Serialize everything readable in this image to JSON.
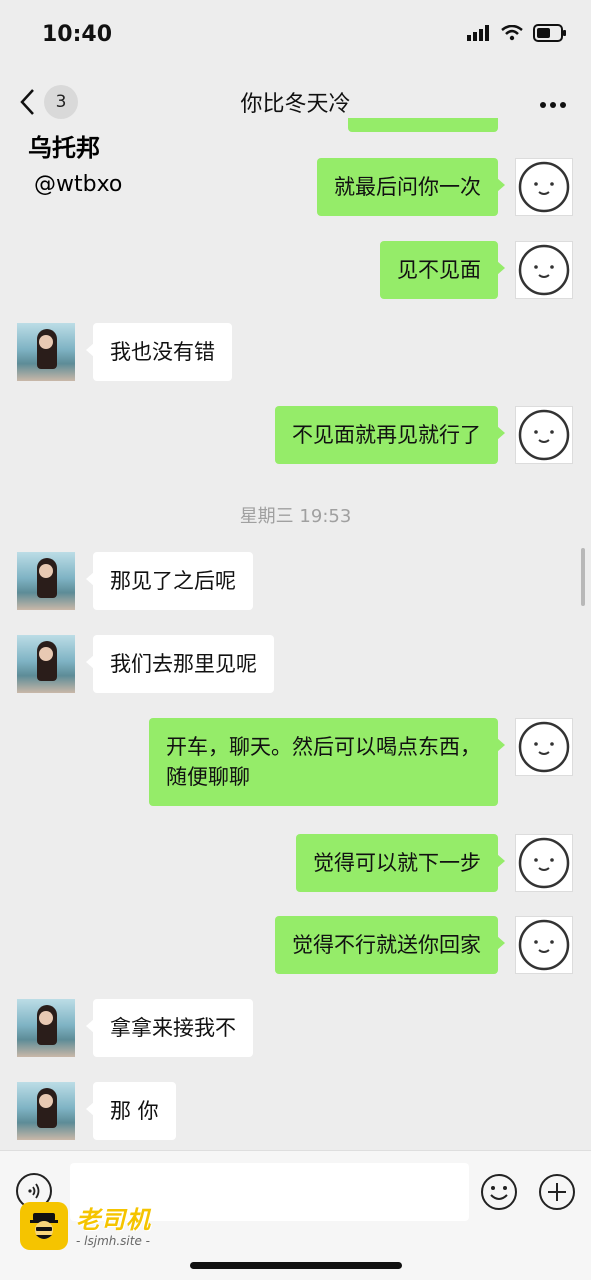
{
  "status_bar": {
    "time": "10:40"
  },
  "nav": {
    "unread_count": "3",
    "title": "你比冬天冷"
  },
  "overlay": {
    "name": "乌托邦",
    "handle": "@wtbxo"
  },
  "messages": [
    {
      "side": "right",
      "text": "就最后问你一次"
    },
    {
      "side": "right",
      "text": "见不见面"
    },
    {
      "side": "left",
      "text": "我也没有错"
    },
    {
      "side": "right",
      "text": "不见面就再见就行了"
    },
    {
      "side": "left",
      "text": "那见了之后呢"
    },
    {
      "side": "left",
      "text": "我们去那里见呢"
    },
    {
      "side": "right",
      "text": "开车，聊天。然后可以喝点东西，\n随便聊聊"
    },
    {
      "side": "right",
      "text": "觉得可以就下一步"
    },
    {
      "side": "right",
      "text": "觉得不行就送你回家"
    },
    {
      "side": "left",
      "text": "拿拿来接我不"
    },
    {
      "side": "left",
      "text": "那 你"
    }
  ],
  "time_divider": "星期三 19:53",
  "input": {
    "value": ""
  },
  "logo_watermark": {
    "name": "老司机",
    "site": "- lsjmh.site -"
  },
  "colors": {
    "self_bubble": "#95ec69",
    "peer_bubble": "#ffffff",
    "background": "#ededed",
    "logo": "#f5c400"
  },
  "icons": [
    "back-icon",
    "more-icon",
    "signal-icon",
    "wifi-icon",
    "battery-icon",
    "smiley-avatar-icon",
    "voice-icon",
    "emoji-icon",
    "plus-icon"
  ]
}
